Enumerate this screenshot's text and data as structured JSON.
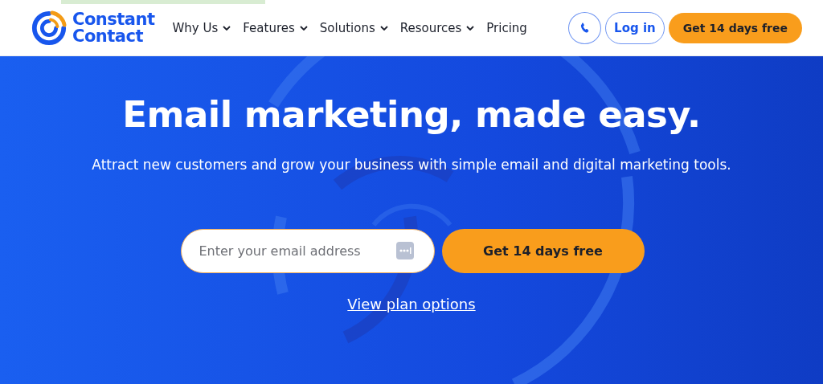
{
  "logo": {
    "line_1": "Constant",
    "line_2": "Contact"
  },
  "nav": [
    {
      "label": "Why Us",
      "has_menu": true
    },
    {
      "label": "Features",
      "has_menu": true
    },
    {
      "label": "Solutions",
      "has_menu": true
    },
    {
      "label": "Resources",
      "has_menu": true
    },
    {
      "label": "Pricing",
      "has_menu": false
    }
  ],
  "header_actions": {
    "login": "Log in",
    "cta": "Get 14 days free"
  },
  "hero": {
    "title": "Email marketing, made easy.",
    "subtitle": "Attract new customers and grow your business with simple email and digital marketing tools.",
    "email": {
      "placeholder": "Enter your email address"
    },
    "cta": "Get 14 days free",
    "link": "View plan options"
  }
}
